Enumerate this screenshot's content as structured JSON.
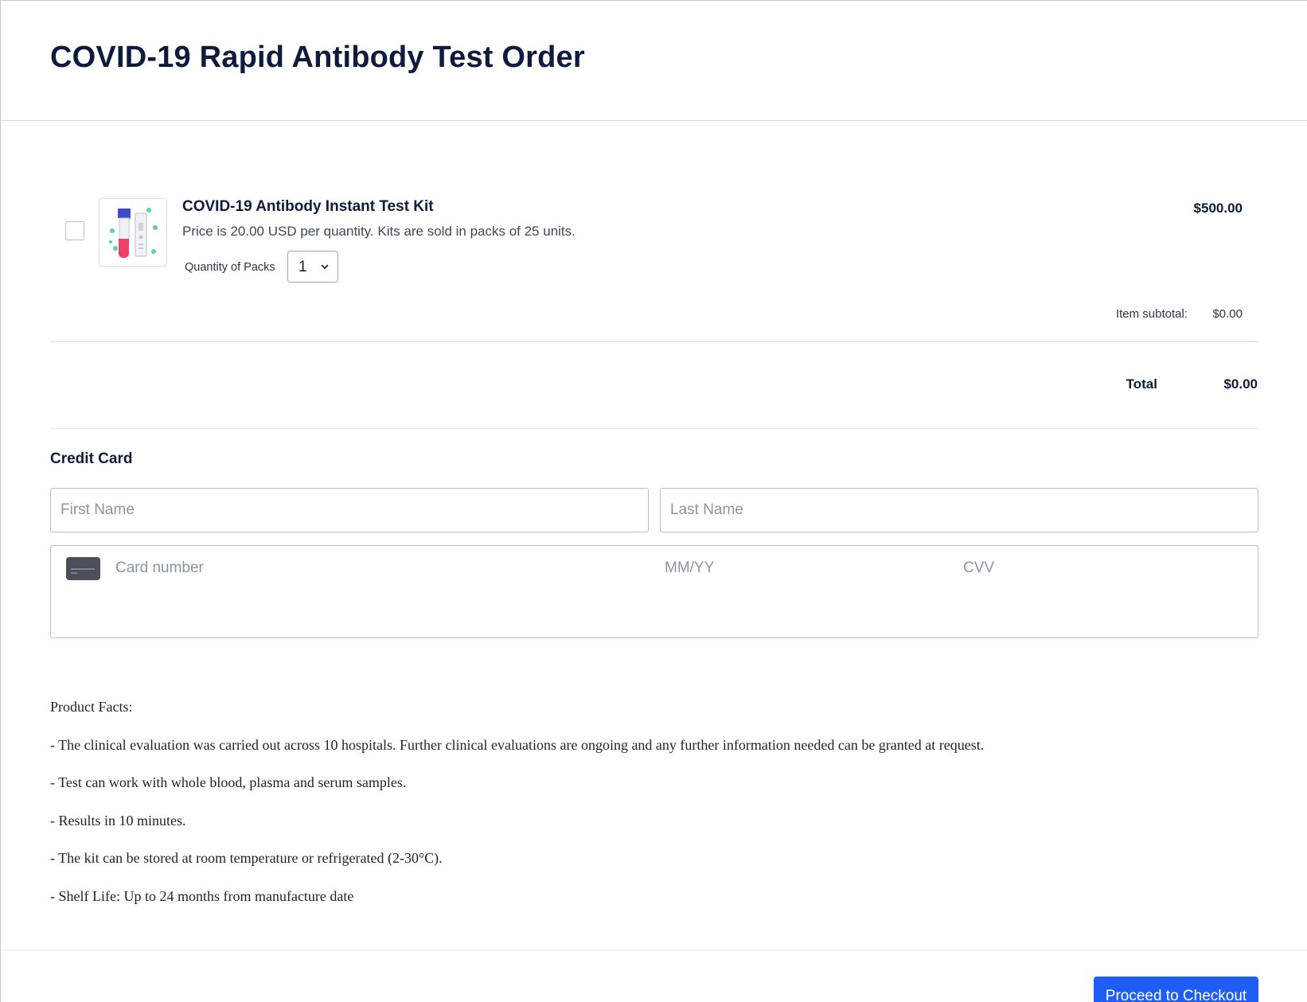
{
  "page": {
    "title": "COVID-19 Rapid Antibody Test Order"
  },
  "product": {
    "name": "COVID-19 Antibody Instant Test Kit",
    "description": "Price is 20.00 USD per quantity. Kits are sold in packs of 25 units.",
    "price": "$500.00",
    "quantity_label": "Quantity of Packs",
    "quantity_value": "1",
    "image_icon": "test-kit-image"
  },
  "summary": {
    "subtotal_label": "Item subtotal:",
    "subtotal_value": "$0.00",
    "total_label": "Total",
    "total_value": "$0.00"
  },
  "payment": {
    "heading": "Credit Card",
    "first_name_placeholder": "First Name",
    "last_name_placeholder": "Last Name",
    "card_number_placeholder": "Card number",
    "exp_placeholder": "MM/YY",
    "cvv_placeholder": "CVV",
    "card_icon": "credit-card-icon"
  },
  "facts": {
    "heading": "Product Facts:",
    "items": [
      "- The clinical evaluation was carried out across 10 hospitals. Further clinical evaluations are ongoing and any further information needed can be granted at request.",
      "- Test can work with whole blood, plasma and serum samples.",
      "- Results in 10 minutes.",
      "- The kit can be stored at room temperature or refrigerated (2-30°C).",
      "- Shelf Life: Up to 24 months from manufacture date"
    ]
  },
  "actions": {
    "checkout_label": "Proceed to Checkout"
  },
  "colors": {
    "accent": "#1f5ef5",
    "text": "#0e1b3d"
  }
}
